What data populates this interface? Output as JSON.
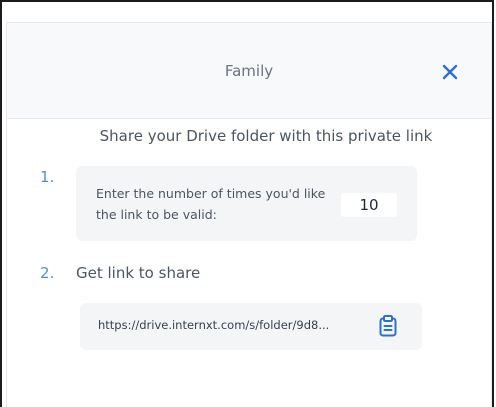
{
  "header": {
    "title": "Family",
    "close_icon": "close-icon"
  },
  "main": {
    "subtitle": "Share your Drive folder with this private link",
    "step1": {
      "number": "1.",
      "label": "Enter the number of times you'd like the link to be valid:",
      "times_value": "10"
    },
    "step2": {
      "number": "2.",
      "label": "Get link to share",
      "link": "https://drive.internxt.com/s/folder/9d8...",
      "copy_icon": "clipboard-icon"
    }
  },
  "colors": {
    "accent": "#4a90e2",
    "box_bg": "#f4f5f7",
    "header_bg": "#f8f9fa"
  }
}
